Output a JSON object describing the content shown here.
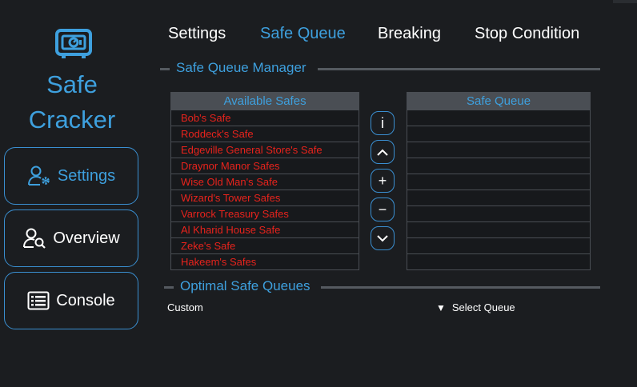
{
  "app": {
    "name_line1": "Safe",
    "name_line2": "Cracker"
  },
  "sidebar": {
    "items": [
      {
        "label": "Settings",
        "icon": "user-gear-icon"
      },
      {
        "label": "Overview",
        "icon": "user-search-icon"
      },
      {
        "label": "Console",
        "icon": "list-icon"
      }
    ]
  },
  "tabs": [
    "Settings",
    "Safe Queue",
    "Breaking",
    "Stop Condition"
  ],
  "active_tab": "Safe Queue",
  "manager": {
    "title": "Safe Queue Manager",
    "available_header": "Available Safes",
    "queue_header": "Safe Queue",
    "available": [
      "Bob's Safe",
      "Roddeck's Safe",
      "Edgeville General Store's Safe",
      "Draynor Manor Safes",
      "Wise Old Man's Safe",
      "Wizard's Tower Safes",
      "Varrock Treasury Safes",
      "Al Kharid House Safe",
      "Zeke's Safe",
      "Hakeem's Safes"
    ],
    "queue": [],
    "buttons": {
      "info": "i",
      "up": "^",
      "add": "+",
      "remove": "−",
      "down": "v"
    }
  },
  "optimal": {
    "title": "Optimal Safe Queues",
    "custom_label": "Custom",
    "select_label": "Select Queue"
  },
  "colors": {
    "accent": "#3ea0de",
    "safe_text": "#e8231c",
    "background": "#1b1d20"
  }
}
